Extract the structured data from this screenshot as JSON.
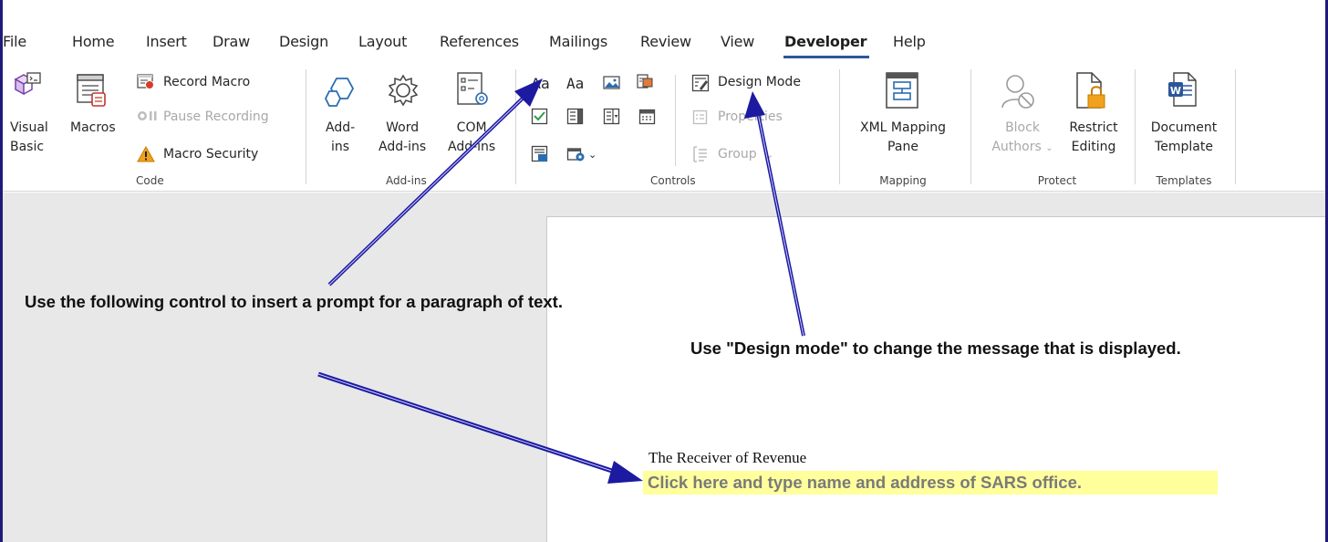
{
  "tabs": [
    "File",
    "Home",
    "Insert",
    "Draw",
    "Design",
    "Layout",
    "References",
    "Mailings",
    "Review",
    "View",
    "Developer",
    "Help"
  ],
  "active_tab": "Developer",
  "code": {
    "visual_basic_1": "Visual",
    "visual_basic_2": "Basic",
    "macros": "Macros",
    "record_macro": "Record Macro",
    "pause_recording": "Pause Recording",
    "macro_security": "Macro Security",
    "group": "Code"
  },
  "addins": {
    "addins_1": "Add-",
    "addins_2": "ins",
    "word_addins_1": "Word",
    "word_addins_2": "Add-ins",
    "com_addins_1": "COM",
    "com_addins_2": "Add-ins",
    "group": "Add-ins"
  },
  "controls": {
    "rich_text": "Aa",
    "plain_text": "Aa",
    "design_mode": "Design Mode",
    "properties": "Properties",
    "group_btn": "Group",
    "group": "Controls"
  },
  "mapping": {
    "xml_1": "XML Mapping",
    "xml_2": "Pane",
    "group": "Mapping"
  },
  "protect": {
    "block_1": "Block",
    "block_2": "Authors",
    "restrict_1": "Restrict",
    "restrict_2": "Editing",
    "group": "Protect"
  },
  "templates": {
    "doc_1": "Document",
    "doc_2": "Template",
    "group": "Templates"
  },
  "callouts": {
    "prompt": "Use the following control to insert a prompt for a paragraph of text.",
    "design": "Use \"Design mode\" to change the message that is displayed."
  },
  "document": {
    "line1": "The Receiver of Revenue",
    "placeholder": "Click here and type name and address of SARS office."
  },
  "colors": {
    "accent": "#2b579a",
    "arrow": "#1c1aa0",
    "highlight": "#ffff9c"
  }
}
